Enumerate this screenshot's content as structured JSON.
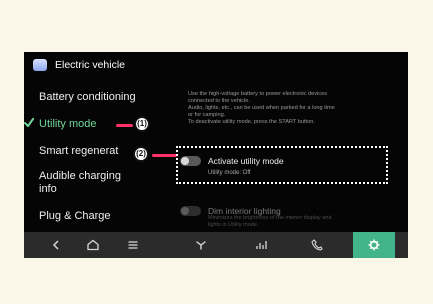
{
  "header": {
    "title": "Electric vehicle"
  },
  "menu": {
    "items": [
      {
        "label": "Battery conditioning",
        "active": false
      },
      {
        "label": "Utility mode",
        "active": true
      },
      {
        "label": "Smart regenerat",
        "active": false
      },
      {
        "label": "Audible charging",
        "active": false
      },
      {
        "label": "info",
        "active": false
      },
      {
        "label": "Plug & Charge",
        "active": false
      }
    ]
  },
  "content": {
    "description": [
      "Use the high-voltage battery to power electronic devices",
      "connected to the vehicle.",
      "Audio, lights, etc., can be used when parked for a long time",
      "or for camping.",
      "To deactivate utility mode, press the START button."
    ],
    "settings": [
      {
        "label": "Activate utility mode",
        "sub": "Utility mode: Off",
        "enabled": true
      },
      {
        "label": "Dim interior lighting",
        "sub_lines": [
          "Minimizes the brightness of the interior display and",
          "lights in Utility mode."
        ],
        "enabled": false
      }
    ]
  },
  "nav": {
    "items": [
      "back-icon",
      "home-icon",
      "menu-icon",
      "climate-fan-icon",
      "signal-bars-icon",
      "phone-icon",
      "settings-icon"
    ],
    "selected": "settings-icon"
  },
  "callouts": [
    {
      "label": "(1)"
    },
    {
      "label": "(2)"
    }
  ],
  "colors": {
    "background": "#fbf7e8",
    "screen": "#050505",
    "active": "#71d79b",
    "accent": "#43b48a",
    "callout_line": "#ff2f67"
  }
}
